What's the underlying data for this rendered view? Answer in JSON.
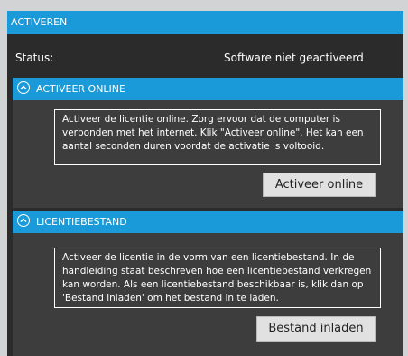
{
  "header": {
    "title": "ACTIVEREN"
  },
  "status": {
    "label": "Status:",
    "value": "Software niet geactiveerd"
  },
  "online_section": {
    "title": "ACTIVEER ONLINE",
    "description": "Activeer de licentie online. Zorg ervoor dat de computer is verbonden met het internet. Klik \"Activeer online\". Het kan een aantal seconden duren voordat de activatie is voltooid.",
    "button_label": "Activeer online"
  },
  "file_section": {
    "title": "LICENTIEBESTAND",
    "description": "Activeer de licentie in de vorm van een licentiebestand. In de handleiding staat beschreven hoe een licentiebestand verkregen kan worden. Als een licentiebestand beschikbaar is, klik dan op 'Bestand inladen' om het bestand in te laden.",
    "button_label": "Bestand inladen"
  },
  "colors": {
    "accent": "#1a9ad8",
    "panel_bg": "#2b2b2b",
    "section_bg": "#3d3d3d",
    "page_bg": "#d2d3d5"
  },
  "icons": {
    "section_toggle": "chevron-up-circle-icon"
  }
}
